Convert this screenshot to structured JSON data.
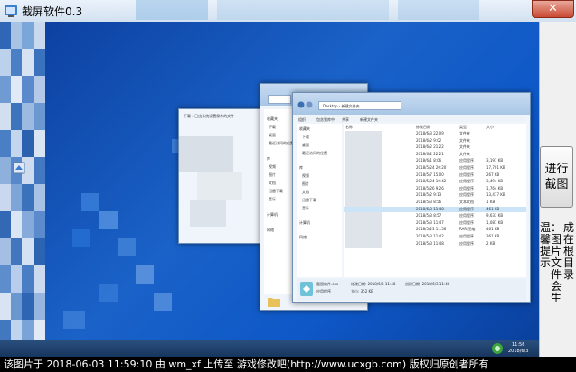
{
  "window": {
    "title": "截屏软件0.3",
    "close_glyph": "✕"
  },
  "actions": {
    "capture_label": "进行截图"
  },
  "hint": {
    "text": "温馨提示：图片文件会生成在根目录"
  },
  "screenshot": {
    "back_window": {
      "title": "下载",
      "breadcrumb": "下载 › 已由系统设置保存的文件",
      "sidebar": [
        "收藏夹",
        "下载",
        "桌面",
        "最近访问的位置",
        "库",
        "视频",
        "图片",
        "文档",
        "迅雷下载",
        "音乐",
        "计算机",
        "网络"
      ]
    },
    "front_window": {
      "breadcrumb": "Desktop › 新建文件夹",
      "toolbar": [
        "组织",
        "包含到库中",
        "共享",
        "新建文件夹"
      ],
      "columns": [
        "名称",
        "修改日期",
        "类型",
        "大小"
      ],
      "sidebar": [
        "收藏夹",
        "下载",
        "桌面",
        "最近访问的位置",
        "库",
        "视频",
        "图片",
        "文档",
        "迅雷下载",
        "音乐",
        "计算机",
        "网络"
      ],
      "rows": [
        {
          "date": "2018/6/3 22:09",
          "type": "文件夹",
          "size": ""
        },
        {
          "date": "2018/6/2 9:02",
          "type": "文件夹",
          "size": ""
        },
        {
          "date": "2018/6/2 21:22",
          "type": "文件夹",
          "size": ""
        },
        {
          "date": "2018/6/2 22:21",
          "type": "文件夹",
          "size": ""
        },
        {
          "date": "2018/6/1 8:06",
          "type": "应用程序",
          "size": "3,191 KB"
        },
        {
          "date": "2018/5/24 20:20",
          "type": "应用程序",
          "size": "17,701 KB"
        },
        {
          "date": "2018/5/7 15:00",
          "type": "应用程序",
          "size": "267 KB"
        },
        {
          "date": "2018/5/24 19:42",
          "type": "应用程序",
          "size": "3,494 KB"
        },
        {
          "date": "2018/5/26 9:26",
          "type": "应用程序",
          "size": "1,764 KB"
        },
        {
          "date": "2018/5/2 9:13",
          "type": "应用程序",
          "size": "13,477 KB"
        },
        {
          "date": "2018/5/3 8:56",
          "type": "文本文档",
          "size": "1 KB"
        },
        {
          "date": "2018/6/3 11:48",
          "type": "应用程序",
          "size": "461 KB"
        },
        {
          "date": "2018/5/3 8:57",
          "type": "应用程序",
          "size": "9,633 KB"
        },
        {
          "date": "2018/5/3 11:47",
          "type": "应用程序",
          "size": "1,081 KB"
        },
        {
          "date": "2018/5/23 11:56",
          "type": "RAR 压缩",
          "size": "461 KB"
        },
        {
          "date": "2018/5/3 11:42",
          "type": "应用程序",
          "size": "361 KB"
        },
        {
          "date": "2018/5/3 11:48",
          "type": "应用程序",
          "size": "2 KB"
        }
      ],
      "details": {
        "name": "截图软件.exe",
        "modified": "修改日期: 2018/6/3 11:48",
        "created": "创建日期: 2018/6/3 11:48",
        "type": "应用程序",
        "size": "大小: 352 KB"
      }
    },
    "clock": {
      "time": "11:56",
      "date": "2018/6/3"
    }
  },
  "footer": {
    "text": "该图片于 2018-06-03 11:59:10 由 wm_xf 上传至 游戏修改吧(http://www.ucxgb.com) 版权归原创者所有"
  },
  "colors": {
    "desktop": "#1a62c8",
    "taskbar": "#17365e",
    "footer_bg": "#000000",
    "close_button": "#c94a33"
  }
}
